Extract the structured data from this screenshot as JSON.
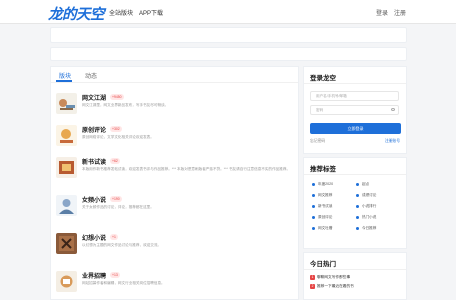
{
  "header": {
    "logo": "龙的天空",
    "nav": [
      "全站版块",
      "APP下载"
    ],
    "auth": {
      "login": "登录",
      "register": "注册"
    }
  },
  "main": {
    "tabs": [
      {
        "label": "版块",
        "active": true
      },
      {
        "label": "动态",
        "active": false
      }
    ],
    "boards": [
      {
        "name": "网文江湖",
        "badge": "+9450",
        "desc": "网文江湖里，网文业界新品发布，写手书友尽可畅谈。"
      },
      {
        "name": "原创评论",
        "badge": "+302",
        "desc": "原创网络评论，文学文化相关评论欢迎发表。"
      },
      {
        "name": "新书试读",
        "badge": "+62",
        "desc": "本版用作新书推荐发帖试读，欢迎发表书评与作品推荐。*** 本版对恶意刷版者严惩不贷。*** 书友请自行注意信息不实的作品推荐。"
      },
      {
        "name": "女频小说",
        "badge": "+190",
        "desc": "关于女频作品的讨论，评论，推荐都在这里。"
      },
      {
        "name": "幻想小说",
        "badge": "+1",
        "desc": "以幻想为主题的网文作品讨论与推荐，欢迎交流。"
      },
      {
        "name": "业界招聘",
        "badge": "+13",
        "desc": "网站招募作者和编辑，网文行业相关岗位招聘信息。"
      }
    ]
  },
  "sidebar": {
    "login": {
      "title": "登录龙空",
      "username_placeholder": "用户名/手机号/邮箱",
      "password_placeholder": "密码",
      "button": "立即登录",
      "forgot": "忘记密码",
      "register": "注册账号"
    },
    "tags": {
      "title": "推荐标签",
      "items": [
        "年度2020",
        "起点",
        "网文推荐",
        "成绩讨论",
        "新书试读",
        "小说排行",
        "原创评论",
        "热门小说",
        "网文吐槽",
        "今日推荐"
      ]
    },
    "hot": {
      "title": "今日热门",
      "items": [
        "聊聊网文写作那些事",
        "推荐一下最近在看的书"
      ]
    }
  },
  "colors": {
    "accent": "#1e6fd9",
    "badge": "#e64545"
  }
}
